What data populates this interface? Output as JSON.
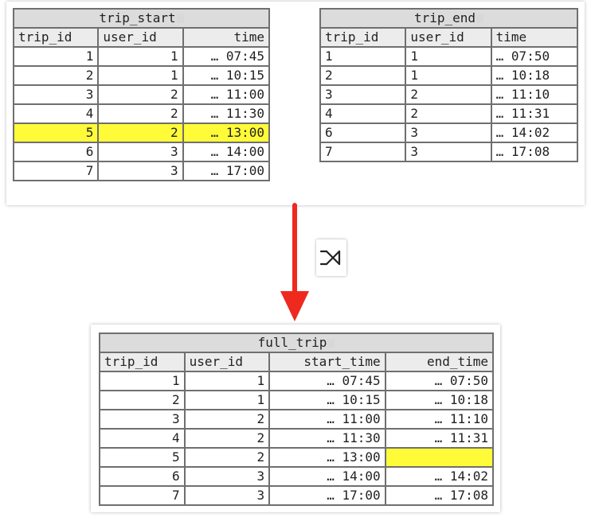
{
  "trip_start": {
    "title": "trip_start",
    "headers": [
      "trip_id",
      "user_id",
      "time"
    ],
    "rows": [
      [
        "1",
        "1",
        "… 07:45"
      ],
      [
        "2",
        "1",
        "… 10:15"
      ],
      [
        "3",
        "2",
        "… 11:00"
      ],
      [
        "4",
        "2",
        "… 11:30"
      ],
      [
        "5",
        "2",
        "… 13:00"
      ],
      [
        "6",
        "3",
        "… 14:00"
      ],
      [
        "7",
        "3",
        "… 17:00"
      ]
    ],
    "highlighted_row": 4
  },
  "trip_end": {
    "title": "trip_end",
    "headers": [
      "trip_id",
      "user_id",
      "time"
    ],
    "rows": [
      [
        "1",
        "1",
        "… 07:50"
      ],
      [
        "2",
        "1",
        "… 10:18"
      ],
      [
        "3",
        "2",
        "… 11:10"
      ],
      [
        "4",
        "2",
        "… 11:31"
      ],
      [
        "6",
        "3",
        "… 14:02"
      ],
      [
        "7",
        "3",
        "… 17:08"
      ]
    ]
  },
  "join_symbol": "left-outer-join-icon",
  "full_trip": {
    "title": "full_trip",
    "headers": [
      "trip_id",
      "user_id",
      "start_time",
      "end_time"
    ],
    "rows": [
      [
        "1",
        "1",
        "… 07:45",
        "… 07:50"
      ],
      [
        "2",
        "1",
        "… 10:15",
        "… 10:18"
      ],
      [
        "3",
        "2",
        "… 11:00",
        "… 11:10"
      ],
      [
        "4",
        "2",
        "… 11:30",
        "… 11:31"
      ],
      [
        "5",
        "2",
        "… 13:00",
        ""
      ],
      [
        "6",
        "3",
        "… 14:00",
        "… 14:02"
      ],
      [
        "7",
        "3",
        "… 17:00",
        "… 17:08"
      ]
    ],
    "highlighted_cell": [
      4,
      3
    ]
  },
  "colors": {
    "highlight": "#fffb38",
    "arrow": "#ee2a1f",
    "title_bg": "#dcdcdc",
    "header_bg": "#ececec",
    "border": "#6f6f6f"
  }
}
